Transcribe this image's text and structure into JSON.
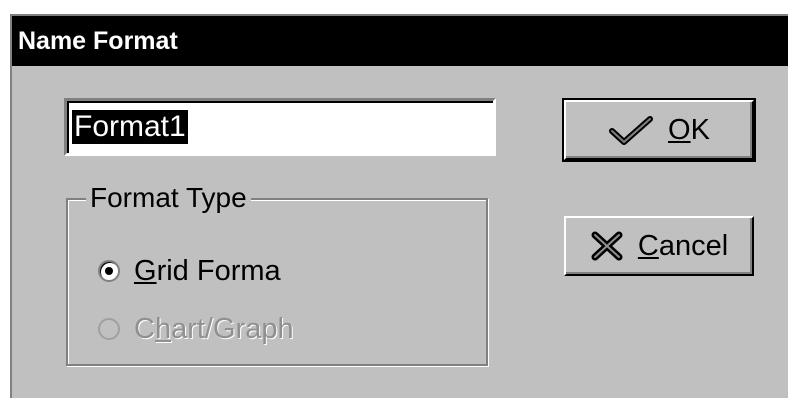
{
  "dialog": {
    "title": "Name Format",
    "name_value": "Format1",
    "group_label": "Format Type",
    "options": [
      {
        "mnemonic": "G",
        "rest": "rid Forma",
        "selected": true,
        "enabled": true
      },
      {
        "prefix": "C",
        "mnemonic": "h",
        "rest": "art/Graph",
        "selected": false,
        "enabled": false
      }
    ],
    "ok": {
      "mnemonic": "O",
      "rest": "K",
      "icon": "checkmark-icon"
    },
    "cancel": {
      "mnemonic": "C",
      "rest": "ancel",
      "icon": "x-icon"
    }
  }
}
